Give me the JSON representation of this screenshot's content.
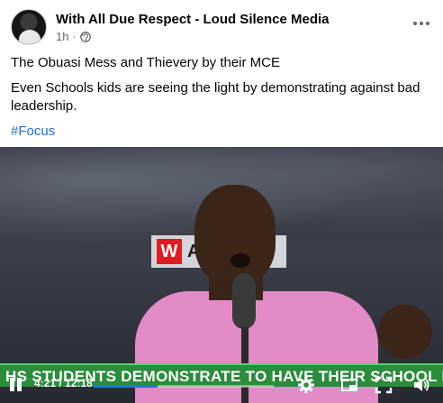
{
  "post": {
    "author": "With All Due Respect - Loud Silence Media",
    "time": "1h",
    "separator": "·",
    "title_line": "The Obuasi Mess and Thievery by their MCE",
    "body_line": "Even Schools kids are seeing the light by demonstrating against bad leadership.",
    "hashtag": "#Focus"
  },
  "video": {
    "logo_mark": "W",
    "logo_text": "A",
    "ticker": "HS STUDENTS DEMONSTRATE TO HAVE THEIR SCHOOL FIXED",
    "time_display": "4:21 / 12:18",
    "progress": 0.354
  },
  "colors": {
    "hashtag": "#216fdb",
    "ticker_bg": "#2b8c3c",
    "progress": "#1877f2",
    "shirt": "#e28bc6"
  },
  "icons": [
    "globe-icon",
    "more-icon",
    "pause-icon",
    "settings-icon",
    "miniplayer-icon",
    "fullscreen-icon",
    "volume-icon"
  ]
}
